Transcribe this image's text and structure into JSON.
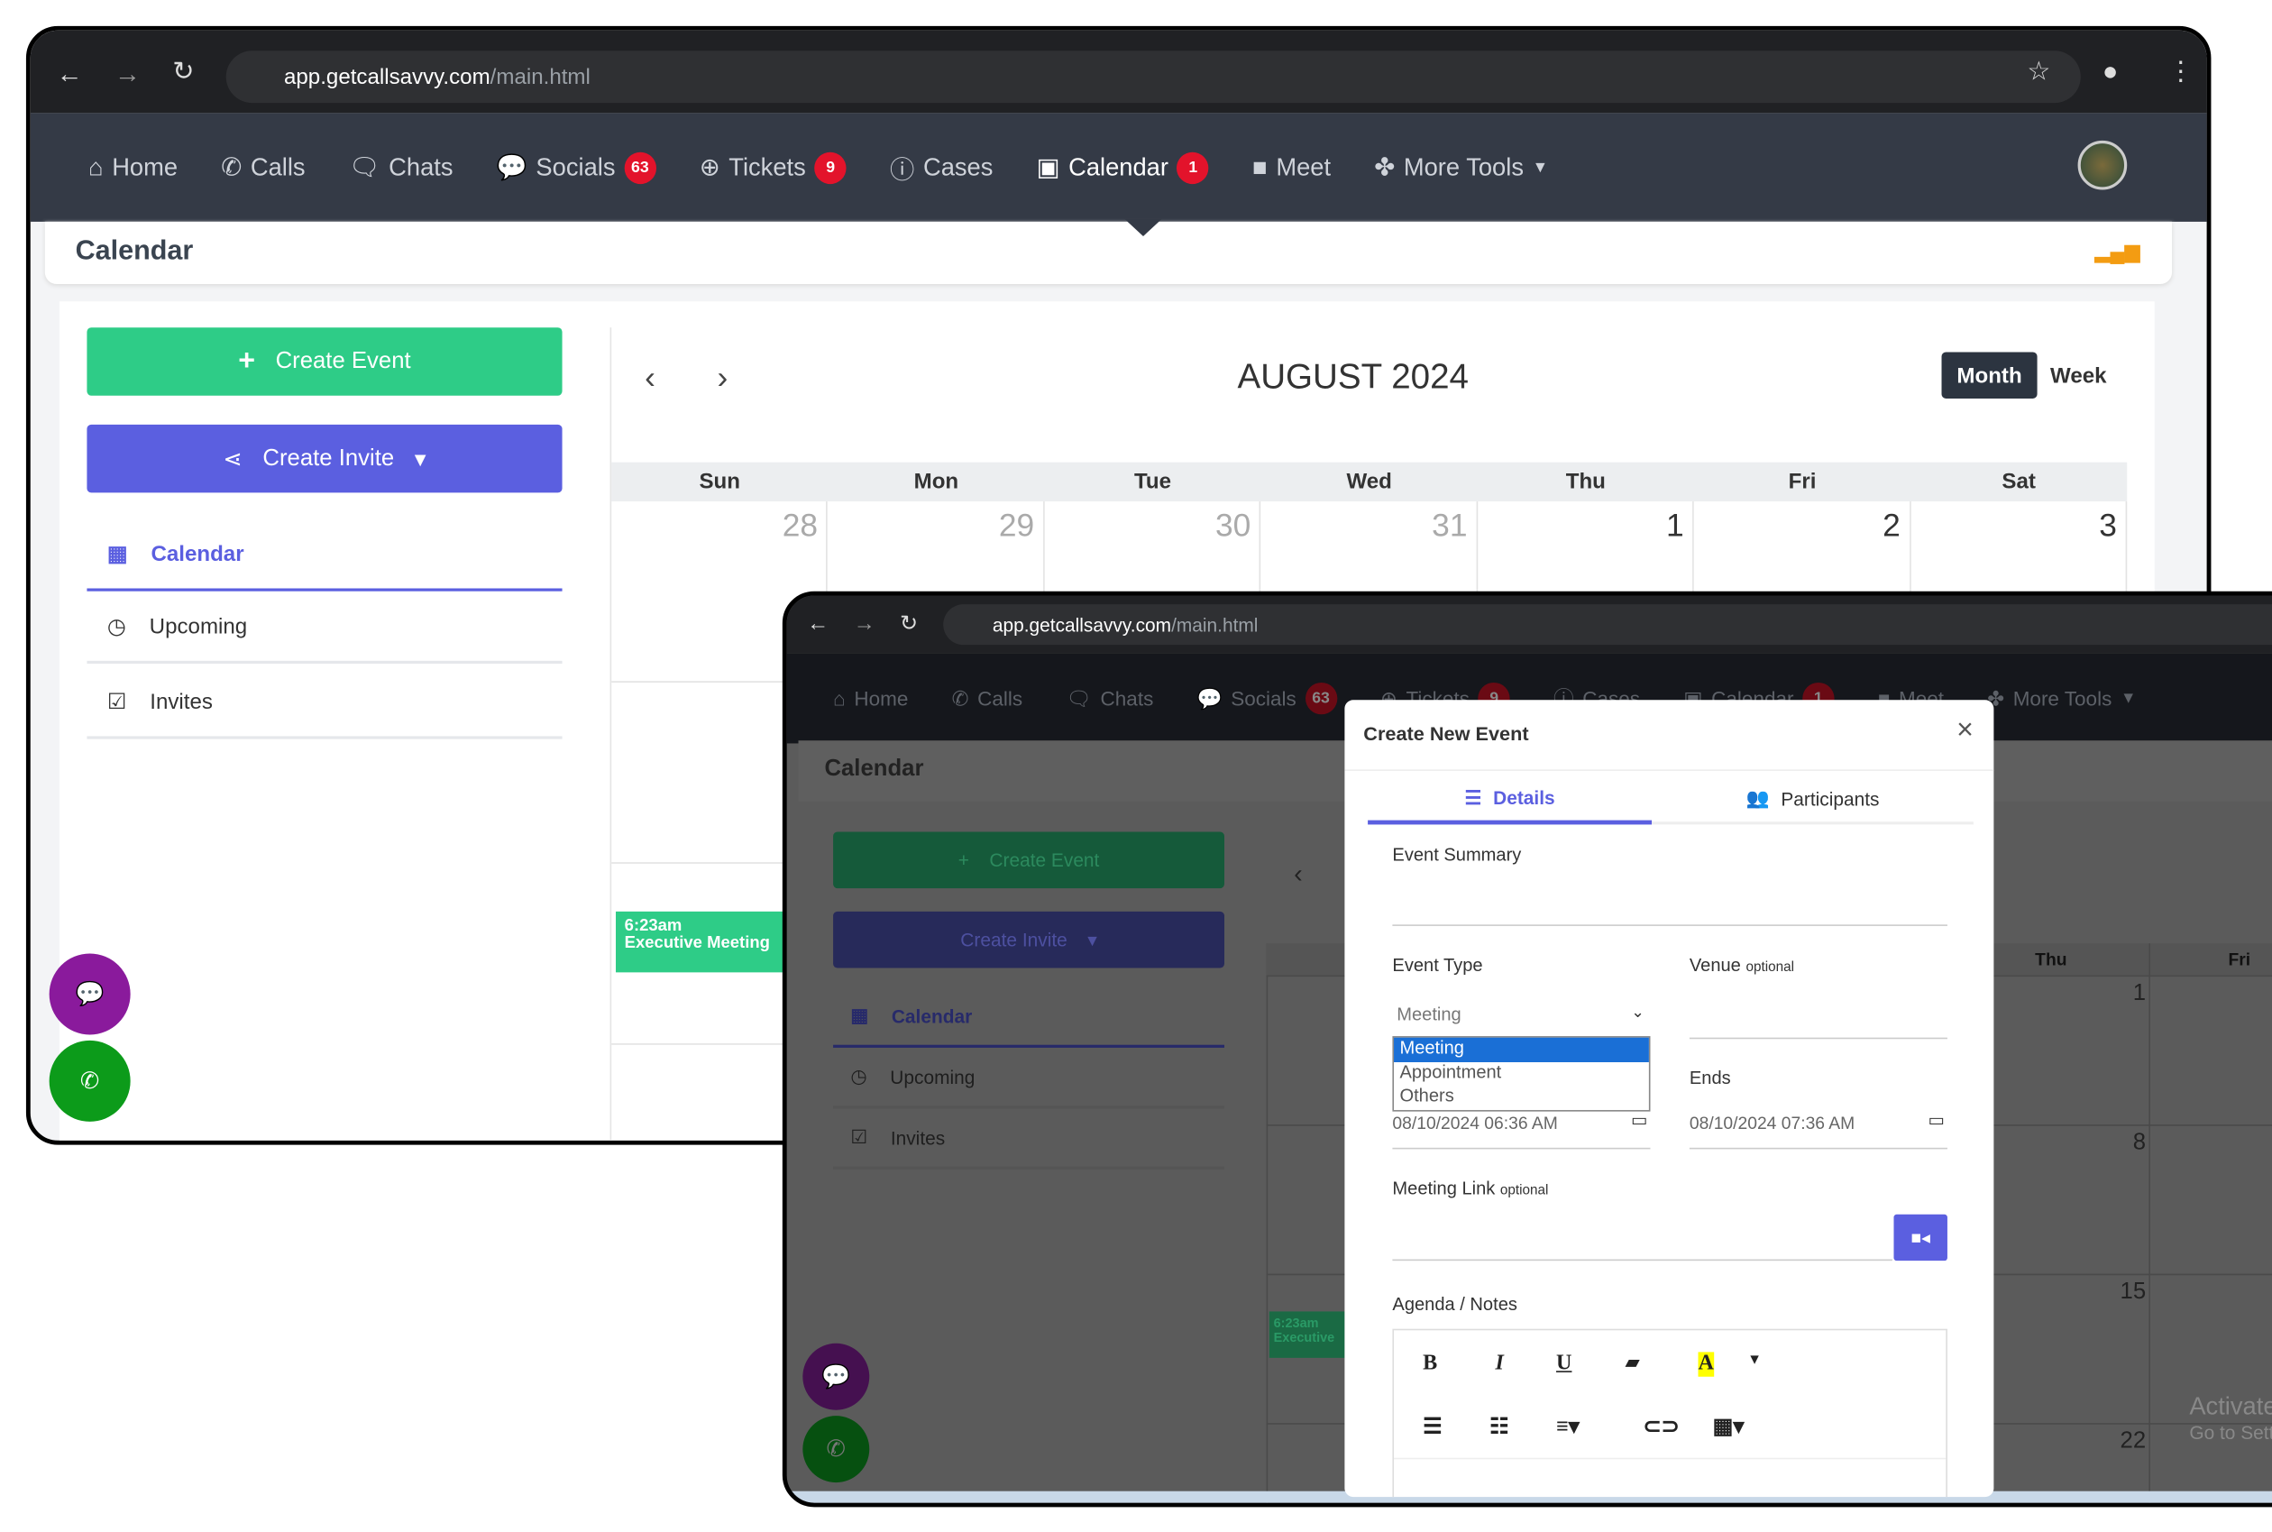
{
  "browser": {
    "url_host": "app.getcallsavvy.com",
    "url_path": "/main.html"
  },
  "nav": {
    "items": [
      {
        "label": "Home",
        "icon": "home-icon"
      },
      {
        "label": "Calls",
        "icon": "phone-icon"
      },
      {
        "label": "Chats",
        "icon": "chat-icon"
      },
      {
        "label": "Socials",
        "icon": "comments-icon",
        "badge": "63"
      },
      {
        "label": "Tickets",
        "icon": "lifebuoy-icon",
        "badge": "9"
      },
      {
        "label": "Cases",
        "icon": "info-icon"
      },
      {
        "label": "Calendar",
        "icon": "calendar-icon",
        "badge": "1",
        "active": true
      },
      {
        "label": "Meet",
        "icon": "video-icon"
      },
      {
        "label": "More Tools",
        "icon": "tools-icon",
        "dropdown": true
      }
    ]
  },
  "page": {
    "title": "Calendar"
  },
  "sidebar": {
    "create_event": "Create Event",
    "create_invite": "Create Invite",
    "items": [
      {
        "label": "Calendar",
        "active": true
      },
      {
        "label": "Upcoming"
      },
      {
        "label": "Invites"
      }
    ]
  },
  "calendar": {
    "month_title": "AUGUST 2024",
    "view_month": "Month",
    "view_week": "Week",
    "days": [
      "Sun",
      "Mon",
      "Tue",
      "Wed",
      "Thu",
      "Fri",
      "Sat"
    ],
    "first_row": [
      "28",
      "29",
      "30",
      "31",
      "1",
      "2",
      "3"
    ],
    "event": {
      "time": "6:23am",
      "title": "Executive Meeting"
    },
    "front_thu_dates": [
      "1",
      "8",
      "15",
      "22"
    ],
    "front_event_time": "6:23am",
    "front_event_title": "Executive"
  },
  "modal": {
    "title": "Create New Event",
    "close": "×",
    "tab_details": "Details",
    "tab_participants": "Participants",
    "event_summary_label": "Event Summary",
    "event_type_label": "Event Type",
    "event_type_value": "Meeting",
    "event_type_options": [
      "Meeting",
      "Appointment",
      "Others"
    ],
    "venue_label": "Venue",
    "optional": "optional",
    "ends_label": "Ends",
    "start_value": "08/10/2024 06:36 AM",
    "end_value": "08/10/2024 07:36 AM",
    "meeting_link_label": "Meeting Link",
    "agenda_label": "Agenda / Notes",
    "toolbar": {
      "bold": "B",
      "italic": "I",
      "underline": "U",
      "highlight": "A"
    }
  },
  "os": {
    "activate_1": "Activate",
    "activate_2": "Go to Sett"
  },
  "colors": {
    "green": "#2ecc87",
    "purple": "#5b5fe0",
    "nav_bg": "#343a46",
    "badge": "#e3132b",
    "fab_chat": "#8a1a9c",
    "fab_phone": "#0c9b1a"
  }
}
